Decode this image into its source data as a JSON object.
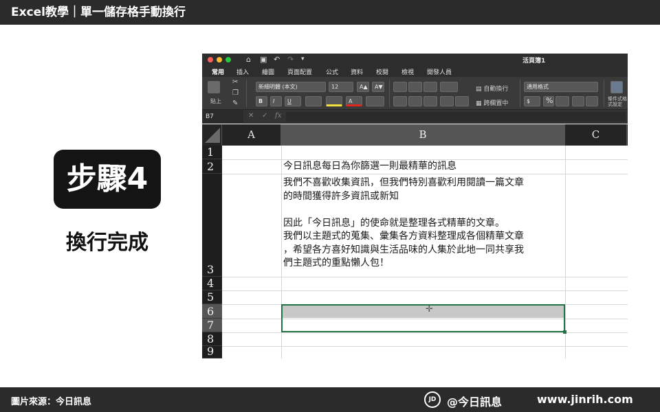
{
  "header": {
    "title": "Excel教學｜單一儲存格手動換行"
  },
  "step": {
    "badge": "步驟4",
    "caption": "換行完成"
  },
  "excel": {
    "window_title": "活頁簿1",
    "quick_access": {
      "undo": "↶",
      "redo": "↷"
    },
    "tabs": [
      "常用",
      "插入",
      "繪圖",
      "頁面配置",
      "公式",
      "資料",
      "校閱",
      "檢視",
      "開發人員"
    ],
    "ribbon": {
      "paste": "貼上",
      "font_name": "新細明體 (本文)",
      "font_size": "12",
      "grow_font": "A▲",
      "shrink_font": "A▼",
      "bold": "B",
      "italic": "I",
      "underline": "U",
      "wrap_text": "自動換行",
      "merge_center": "跨欄置中",
      "number_format": "通用格式",
      "currency": "$",
      "percent": "%",
      "conditional_format": "條件式格式設定"
    },
    "formula_bar": {
      "name_box": "B7",
      "cancel": "✕",
      "confirm": "✓",
      "fx": "fx",
      "value": ""
    },
    "columns": [
      "A",
      "B",
      "C"
    ],
    "selected_column": "B",
    "rows": [
      "1",
      "2",
      "3",
      "4",
      "5",
      "6",
      "7",
      "8",
      "9"
    ],
    "selected_rows": [
      "6",
      "7"
    ],
    "cells": {
      "B2": "今日訊息每日為你篩選一則最精華的訊息",
      "B3_lines": [
        "我們不喜歡收集資訊，但我們特別喜歡利用閱讀一篇文章",
        "的時間獲得許多資訊或新知",
        "",
        "因此「今日訊息」的使命就是整理各式精華的文章。",
        "我們以主題式的蒐集、彙集各方資料整理成各個精華文章",
        "，希望各方喜好知識與生活品味的人集於此地一同共享我",
        "們主題式的重點懶人包！"
      ]
    }
  },
  "footer": {
    "source": "圖片來源：今日訊息",
    "logo": "JD",
    "brand": "@今日訊息",
    "site": "www.jinrih.com"
  }
}
